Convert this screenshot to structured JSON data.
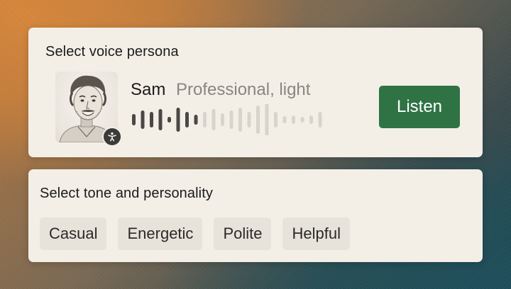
{
  "voice_card": {
    "title": "Select voice persona",
    "persona": {
      "name": "Sam",
      "description": "Professional, light"
    },
    "listen_label": "Listen",
    "played_color": "#4a4845",
    "unplayed_color": "#d8d3cb"
  },
  "tone_card": {
    "title": "Select tone and personality",
    "chips": [
      {
        "label": "Casual"
      },
      {
        "label": "Energetic"
      },
      {
        "label": "Polite"
      },
      {
        "label": "Helpful"
      }
    ]
  },
  "colors": {
    "accent": "#2f7344",
    "card": "#f3efe7",
    "chip": "#e8e3da"
  }
}
